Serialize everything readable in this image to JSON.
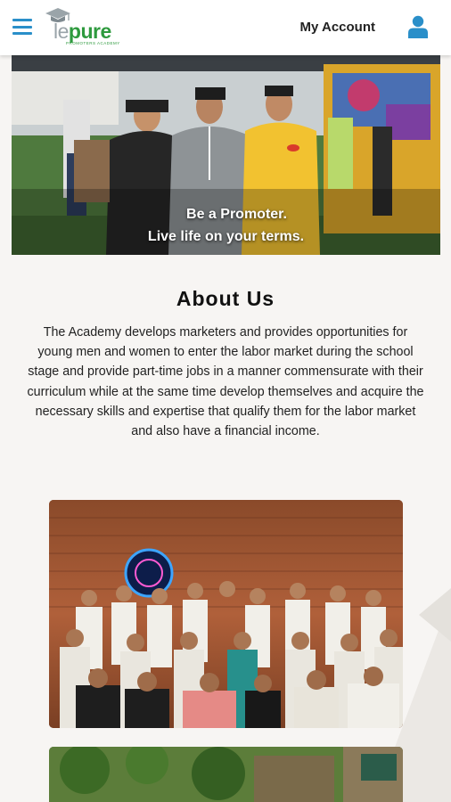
{
  "header": {
    "menu_icon": "hamburger-menu-icon",
    "logo": {
      "le": "le",
      "pure": "pure",
      "tagline": "PROMOTERS ACADEMY",
      "icon": "graduation-cap-icon"
    },
    "account_label": "My Account",
    "user_icon": "user-icon",
    "accent_color": "#2a8fc9",
    "brand_green": "#2e9a3e"
  },
  "hero": {
    "caption_line1": "Be a Promoter.",
    "caption_line2": "Live life on your terms."
  },
  "about": {
    "title": "About Us",
    "body": "The Academy develops marketers and provides opportunities for young men and women to enter the labor market during the school stage and provide part-time jobs in a manner commensurate with their curriculum while at the same time develop themselves and acquire the necessary skills and expertise that qualify them for the labor market and also have a financial income."
  }
}
